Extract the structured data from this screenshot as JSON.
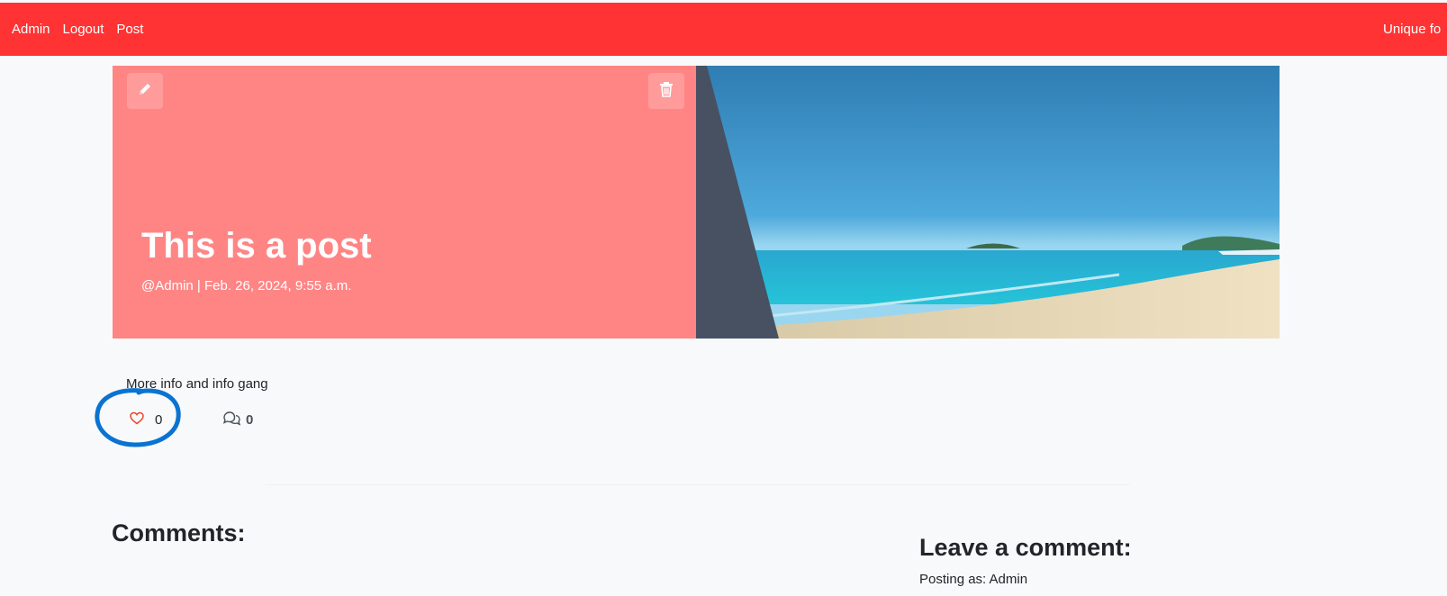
{
  "nav": {
    "links": [
      "Admin",
      "Logout",
      "Post"
    ],
    "brand": "Unique fo"
  },
  "post": {
    "title": "This is a post",
    "meta": "@Admin | Feb. 26, 2024, 9:55 a.m.",
    "body": "More info and info gang",
    "like_count": "0",
    "comment_count": "0"
  },
  "comments": {
    "heading": "Comments:",
    "leave_heading": "Leave a comment:",
    "posting_as": "Posting as: Admin"
  },
  "icons": {
    "edit": "pencil-icon",
    "delete": "trash-icon",
    "like": "heart-icon",
    "comments": "comments-icon"
  },
  "colors": {
    "navbar": "#ff3333",
    "hero_panel": "#ff8585",
    "annotation": "#0a73d2"
  }
}
